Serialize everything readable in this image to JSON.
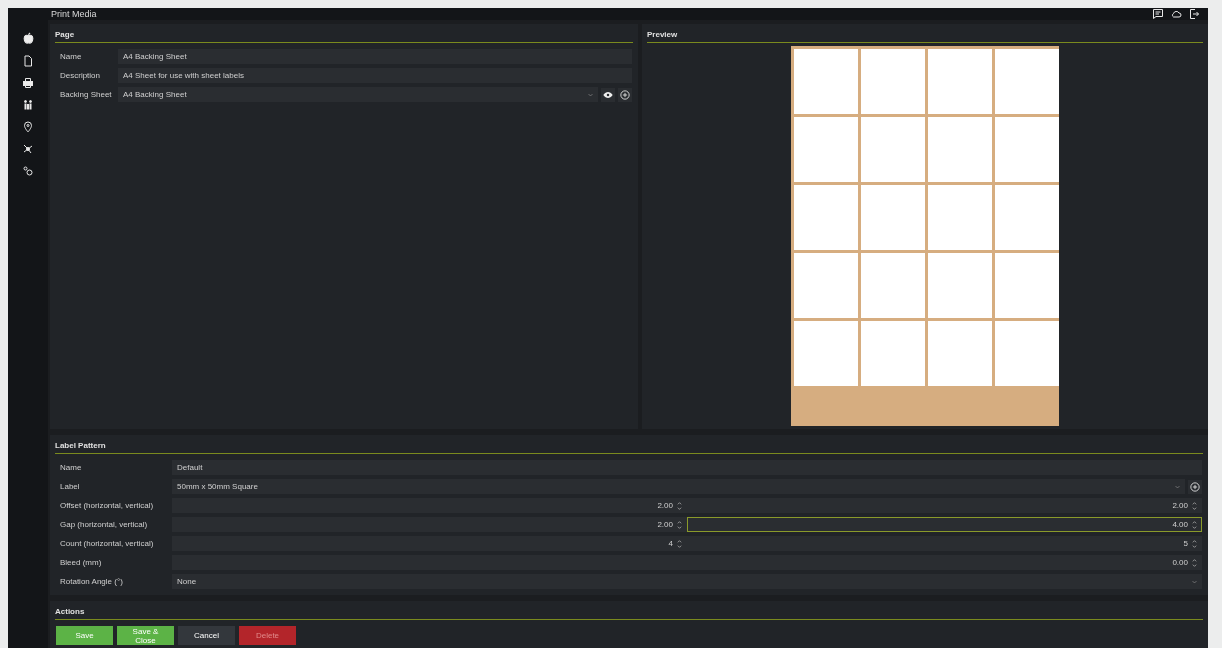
{
  "window": {
    "title": "Print Media"
  },
  "page": {
    "title": "Page",
    "fields": [
      {
        "kind": "text",
        "label": "Name",
        "value": "A4 Backing Sheet"
      },
      {
        "kind": "text",
        "label": "Description",
        "value": "A4 Sheet for use with sheet labels"
      },
      {
        "kind": "select",
        "label": "Backing Sheet",
        "value": "A4 Backing Sheet"
      }
    ]
  },
  "preview": {
    "title": "Preview"
  },
  "label_pattern": {
    "title": "Label Pattern",
    "fields": [
      {
        "kind": "text",
        "label": "Name",
        "value": "Default"
      },
      {
        "kind": "select",
        "label": "Label",
        "value": "50mm x 50mm Square"
      },
      {
        "kind": "pair",
        "label": "Offset (horizontal, vertical)",
        "values": [
          {
            "value": "2.00",
            "focused": false
          },
          {
            "value": "2.00",
            "focused": false
          }
        ]
      },
      {
        "kind": "pair",
        "label": "Gap (horizontal, vertical)",
        "values": [
          {
            "value": "2.00",
            "focused": false
          },
          {
            "value": "4.00",
            "focused": true
          }
        ]
      },
      {
        "kind": "pair",
        "label": "Count (horizontal, vertical)",
        "values": [
          {
            "value": "4",
            "focused": false
          },
          {
            "value": "5",
            "focused": false
          }
        ]
      },
      {
        "kind": "number",
        "label": "Bleed (mm)",
        "values": [
          {
            "value": "0.00",
            "focused": false
          }
        ]
      },
      {
        "kind": "dropdown",
        "label": "Rotation Angle (°)",
        "value": "None"
      }
    ]
  },
  "actions": {
    "title": "Actions",
    "buttons": [
      {
        "kind": "primary",
        "label": "Save"
      },
      {
        "kind": "primary",
        "label": "Save & Close"
      },
      {
        "kind": "secondary",
        "label": "Cancel"
      },
      {
        "kind": "danger",
        "label": "Delete"
      }
    ]
  }
}
